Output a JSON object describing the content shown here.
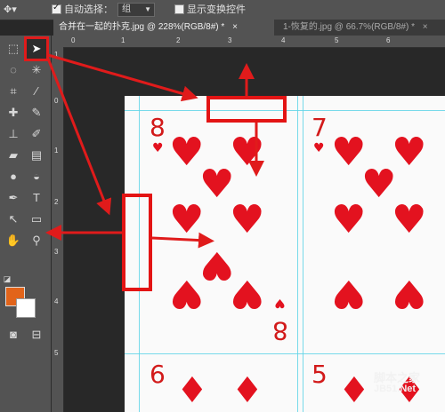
{
  "options_bar": {
    "auto_select_label": "自动选择：",
    "auto_select_value": "组",
    "show_transform_label": "显示变换控件"
  },
  "tabs": [
    {
      "label": "合并在一起的扑克.jpg @ 228%(RGB/8#) *",
      "active": true
    },
    {
      "label": "1-恢复的.jpg @ 66.7%(RGB/8#) *",
      "active": false
    }
  ],
  "close_glyph": "×",
  "ruler_top": [
    "0",
    "1",
    "2",
    "3",
    "4",
    "5",
    "6"
  ],
  "ruler_left": [
    "1",
    "0",
    "1",
    "2",
    "3",
    "4",
    "5"
  ],
  "cards": {
    "eight": {
      "rank": "8",
      "suit": "hearts",
      "bottom_rank": "8"
    },
    "seven": {
      "rank": "7",
      "suit": "hearts"
    },
    "six": {
      "rank": "6",
      "suit": "diamonds"
    },
    "five": {
      "rank": "5",
      "suit": "diamonds"
    }
  },
  "watermark": {
    "line1": "脚本之家",
    "line2": "JB51.Net"
  },
  "colors": {
    "foreground": "#e2641a",
    "background": "#ffffff",
    "annotation": "#e01b1b",
    "guide": "#5fd3e6"
  }
}
